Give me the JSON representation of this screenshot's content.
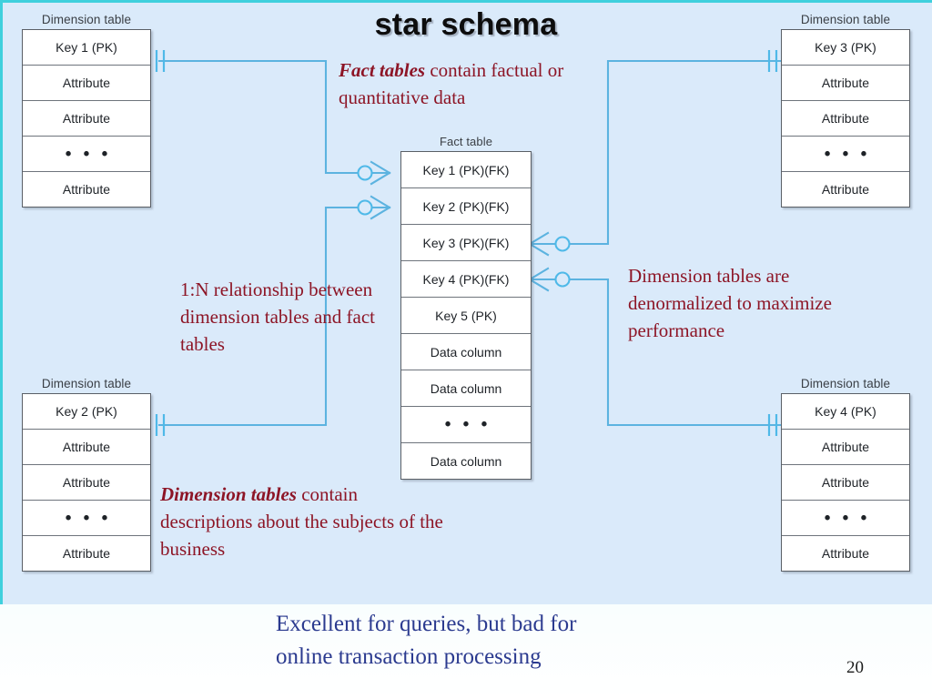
{
  "title": "star schema",
  "page_number": "20",
  "colors": {
    "background_main": "#daeafa",
    "background_footer": "#eafbfc",
    "edge_accent": "#3fd0dd",
    "connector": "#5cb3e0",
    "note_text": "#8d1526",
    "footer_text": "#2b3a8f",
    "table_border": "#5a5f66"
  },
  "tables": {
    "dim1": {
      "caption": "Dimension table",
      "rows": [
        "Key 1 (PK)",
        "Attribute",
        "Attribute",
        "• • •",
        "Attribute"
      ]
    },
    "dim2": {
      "caption": "Dimension table",
      "rows": [
        "Key 2 (PK)",
        "Attribute",
        "Attribute",
        "• • •",
        "Attribute"
      ]
    },
    "dim3": {
      "caption": "Dimension table",
      "rows": [
        "Key 3 (PK)",
        "Attribute",
        "Attribute",
        "• • •",
        "Attribute"
      ]
    },
    "dim4": {
      "caption": "Dimension table",
      "rows": [
        "Key 4 (PK)",
        "Attribute",
        "Attribute",
        "• • •",
        "Attribute"
      ]
    },
    "fact": {
      "caption": "Fact table",
      "rows": [
        "Key 1 (PK)(FK)",
        "Key 2 (PK)(FK)",
        "Key 3 (PK)(FK)",
        "Key 4 (PK)(FK)",
        "Key 5 (PK)",
        "Data column",
        "Data column",
        "• • •",
        "Data column"
      ]
    }
  },
  "notes": {
    "fact_tables": {
      "lead": "Fact tables",
      "body": " contain factual or quantitative data"
    },
    "relationship": {
      "lead": "",
      "body": "1:N relationship between dimension tables and fact tables"
    },
    "denormalized": {
      "lead": "",
      "body": "Dimension tables are denormalized to maximize performance"
    },
    "dimension_tables": {
      "lead": "Dimension tables",
      "body": " contain descriptions about the subjects of the business"
    }
  },
  "footer": {
    "line1": "Excellent for queries, but bad for",
    "line2": "online transaction processing"
  }
}
